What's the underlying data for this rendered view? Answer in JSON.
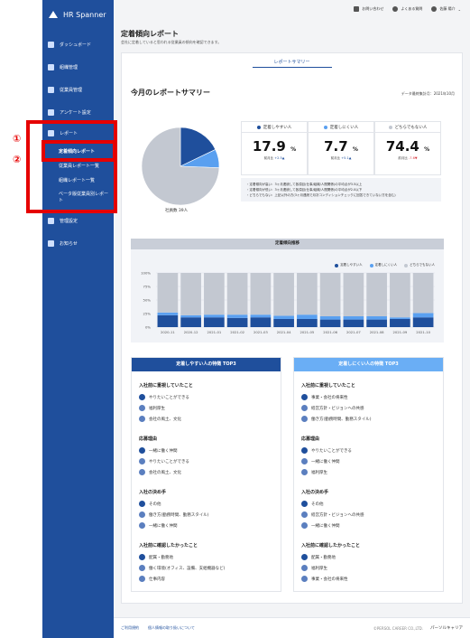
{
  "brand": {
    "name": "HR Spanner"
  },
  "sidebar": {
    "items": [
      {
        "label": "ダッシュボード"
      },
      {
        "label": "組織管理"
      },
      {
        "label": "従業員管理"
      },
      {
        "label": "アンケート設定"
      },
      {
        "label": "レポート"
      },
      {
        "label": "管理設定"
      },
      {
        "label": "お知らせ"
      }
    ],
    "report_sub": [
      {
        "label": "定着傾向レポート"
      },
      {
        "label": "従業員レポート一覧"
      },
      {
        "label": "組織レポート一覧"
      },
      {
        "label": "ベータ版従業員別レポート"
      }
    ]
  },
  "annotations": {
    "marker1": "①",
    "marker2": "②"
  },
  "topbar": {
    "contact": "お問い合わせ",
    "faq": "よくある質問",
    "user": "佐藤 陽介"
  },
  "page": {
    "title": "定着傾向レポート",
    "subtitle": "会社に定着していると思われる従業員の傾向を確認できます。"
  },
  "tabs": {
    "active": "レポートサマリー"
  },
  "summary": {
    "title": "今月のレポートサマリー",
    "data_date": "データ最終集計月：2021年10月",
    "pie_caption": "社員数 39人",
    "stats": [
      {
        "label": "定着しやすい人",
        "value": "17.9",
        "unit": "%",
        "diff_label": "前月比",
        "diff": "+2.5▲",
        "dir": "pos",
        "color": "#1f4f9c"
      },
      {
        "label": "定着しにくい人",
        "value": "7.7",
        "unit": "%",
        "diff_label": "前月比",
        "diff": "+5.1▲",
        "dir": "pos",
        "color": "#5aa0f0"
      },
      {
        "label": "どちらでもない人",
        "value": "74.4",
        "unit": "%",
        "diff_label": "前月比",
        "diff": "-7.6▼",
        "dir": "neg",
        "color": "#c3c8d1"
      }
    ],
    "notes": [
      "・定着傾向が高い：3ヶ月連続して各項目(仕事/組織/人間関係)の平均点が3.5以上",
      "・定着傾向が低い：3ヶ月連続して各項目(仕事/組織/人間関係)の平均点が2.0以下",
      "・どちらでもない：上記以外の方(3ヶ月連続で月次コンディションチェックに回答できていない方を含む)"
    ]
  },
  "chart_data": {
    "type": "bar",
    "title": "定着傾向推移",
    "categories": [
      "2020-11",
      "2020-12",
      "2021-01",
      "2021-02",
      "2021-03",
      "2021-04",
      "2021-05",
      "2021-06",
      "2021-07",
      "2021-08",
      "2021-09",
      "2021-10"
    ],
    "series": [
      {
        "name": "定着しやすい人",
        "color": "#1f4f9c",
        "values": [
          22,
          18,
          18,
          17,
          18,
          15,
          15,
          14,
          14,
          14,
          15,
          18
        ]
      },
      {
        "name": "定着しにくい人",
        "color": "#5aa0f0",
        "values": [
          5,
          4,
          5,
          6,
          5,
          6,
          8,
          6,
          6,
          6,
          3,
          8
        ]
      },
      {
        "name": "どちらでもない人",
        "color": "#c3c8d1",
        "values": [
          73,
          78,
          77,
          77,
          77,
          79,
          77,
          80,
          80,
          80,
          82,
          74
        ]
      }
    ],
    "yticks": [
      "0%",
      "25%",
      "50%",
      "75%",
      "100%"
    ],
    "ylim": [
      0,
      100
    ],
    "stacked": true,
    "legend": "top-right"
  },
  "columns": [
    {
      "header": "定着しやすい人の特徴 TOP3",
      "color": "#1f4f9c",
      "sections": [
        {
          "title": "入社前に重視していたこと",
          "items": [
            "やりたいことができる",
            "福利厚生",
            "会社の風土、文化"
          ]
        },
        {
          "title": "応募理由",
          "items": [
            "一緒に働く仲間",
            "やりたいことができる",
            "会社の風土、文化"
          ]
        },
        {
          "title": "入社の決め手",
          "items": [
            "その他",
            "働き方(勤務時間、勤務スタイル)",
            "一緒に働く仲間"
          ]
        },
        {
          "title": "入社前に確認したかったこと",
          "items": [
            "配属・勤務地",
            "働く環境(オフィス、設備、支給機器など)",
            "仕事内容"
          ]
        }
      ]
    },
    {
      "header": "定着しにくい人の特徴 TOP3",
      "color": "#6aaef5",
      "sections": [
        {
          "title": "入社前に重視していたこと",
          "items": [
            "事業・会社の将来性",
            "経営方針・ビジョンへの共感",
            "働き方(勤務時間、勤務スタイル)"
          ]
        },
        {
          "title": "応募理由",
          "items": [
            "やりたいことができる",
            "一緒に働く仲間",
            "福利厚生"
          ]
        },
        {
          "title": "入社の決め手",
          "items": [
            "その他",
            "経営方針・ビジョンへの共感",
            "一緒に働く仲間"
          ]
        },
        {
          "title": "入社前に確認したかったこと",
          "items": [
            "配属・勤務地",
            "福利厚生",
            "事業・会社の将来性"
          ]
        }
      ]
    }
  ],
  "footer": {
    "link1": "ご利用規約",
    "link2": "個人情報の取り扱いについて",
    "copyright": "©PERSOL CAREER CO.,LTD.",
    "brand": "パーソルキャリア"
  }
}
